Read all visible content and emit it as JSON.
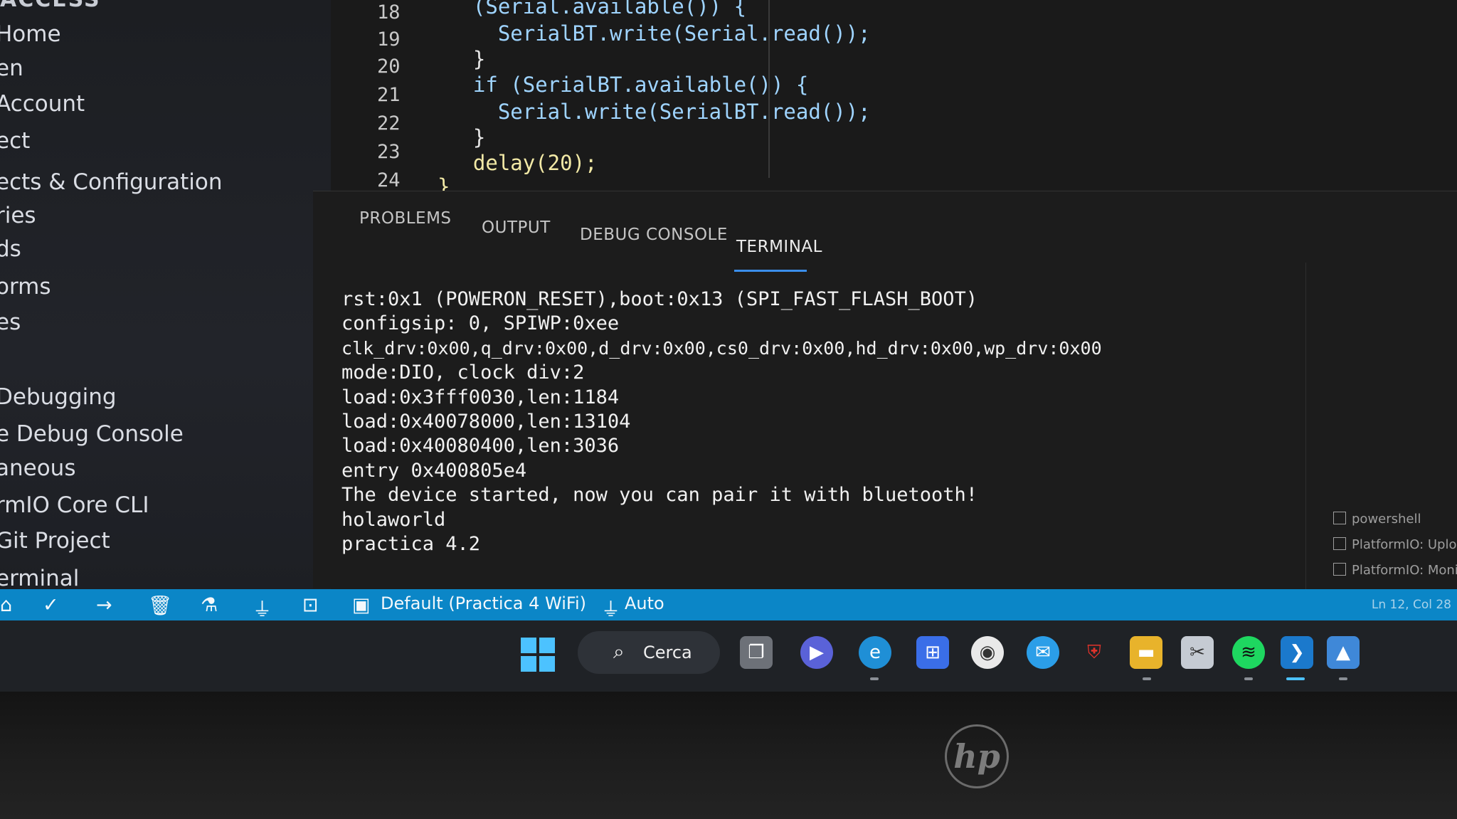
{
  "sidebar": {
    "header": "ACCESS",
    "items": [
      {
        "label": "Home"
      },
      {
        "label": "en"
      },
      {
        "label": "Account"
      },
      {
        "label": "ect"
      },
      {
        "label": "ects & Configuration"
      },
      {
        "label": "ries"
      },
      {
        "label": "ds"
      },
      {
        "label": "orms"
      },
      {
        "label": "es"
      },
      {
        "label": "Debugging"
      },
      {
        "label": "e Debug Console"
      },
      {
        "label": "aneous"
      },
      {
        "label": "rmIO Core CLI"
      },
      {
        "label": "Git Project"
      },
      {
        "label": "erminal"
      }
    ]
  },
  "editor": {
    "line_numbers": [
      "18",
      "19",
      "20",
      "21",
      "22",
      "23",
      "24"
    ],
    "lines": [
      "  (Serial.available()) {",
      "    SerialBT.write(Serial.read());",
      "  }",
      "  if (SerialBT.available()) {",
      "    Serial.write(SerialBT.read());",
      "  }",
      "  delay(20);",
      "}"
    ]
  },
  "panel": {
    "tabs": [
      "PROBLEMS",
      "OUTPUT",
      "DEBUG CONSOLE",
      "TERMINAL"
    ],
    "active_tab": "TERMINAL",
    "terminal_lines": [
      "rst:0x1 (POWERON_RESET),boot:0x13 (SPI_FAST_FLASH_BOOT)",
      "configsip: 0, SPIWP:0xee",
      "clk_drv:0x00,q_drv:0x00,d_drv:0x00,cs0_drv:0x00,hd_drv:0x00,wp_drv:0x00",
      "mode:DIO, clock div:2",
      "load:0x3fff0030,len:1184",
      "load:0x40078000,len:13104",
      "load:0x40080400,len:3036",
      "entry 0x400805e4",
      "The device started, now you can pair it with bluetooth!",
      "holaworld",
      "practica 4.2"
    ],
    "terminal_list": [
      {
        "icon": "terminal-icon",
        "label": "powershell"
      },
      {
        "icon": "terminal-icon",
        "label": "PlatformIO: Upload (es"
      },
      {
        "icon": "terminal-icon",
        "label": "PlatformIO: Monitor (P"
      }
    ]
  },
  "statusbar": {
    "env_label": "Default (Practica 4 WiFi)",
    "port_label": "Auto",
    "cursor_pos": "Ln 12, Col 28",
    "icons": [
      "home-icon",
      "check-icon",
      "arrow-right-icon",
      "trash-icon",
      "flask-icon",
      "plug-icon",
      "terminal-icon"
    ]
  },
  "taskbar": {
    "search_label": "Cerca",
    "apps": [
      "windows-start-icon",
      "task-view-icon",
      "chat-icon",
      "edge-icon",
      "store-icon",
      "app-icon",
      "mail-icon",
      "mcafee-icon",
      "file-explorer-icon",
      "snipping-icon",
      "spotify-icon",
      "vscode-icon",
      "photos-icon"
    ]
  },
  "brand": {
    "logo_text": "hp"
  },
  "colors": {
    "statusbar": "#0b86c7",
    "tab_underline": "#3b8eea",
    "terminal_text": "#f1f1f1",
    "code_identifier": "#9fd4ff",
    "code_function": "#f2e9a6"
  }
}
